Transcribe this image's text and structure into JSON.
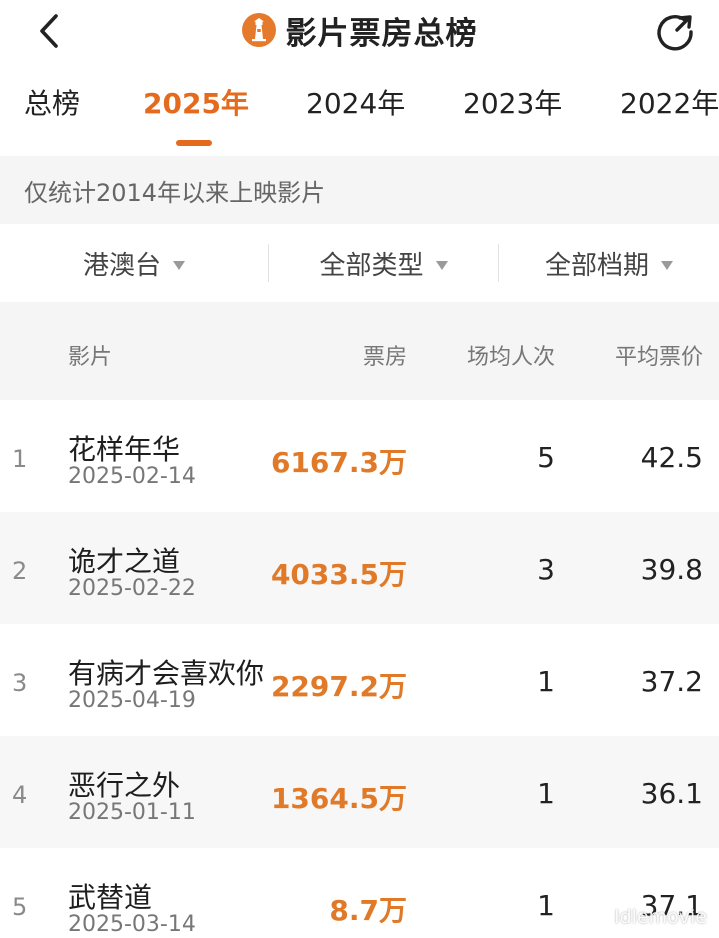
{
  "header": {
    "title": "影片票房总榜",
    "back_icon": "chevron-left-icon",
    "logo_icon": "lighthouse-logo-icon",
    "share_icon": "share-icon"
  },
  "tabs": [
    {
      "label": "总榜",
      "active": false
    },
    {
      "label": "2025年",
      "active": true
    },
    {
      "label": "2024年",
      "active": false
    },
    {
      "label": "2023年",
      "active": false
    },
    {
      "label": "2022年",
      "active": false
    }
  ],
  "notice": "仅统计2014年以来上映影片",
  "filters": [
    {
      "label": "港澳台"
    },
    {
      "label": "全部类型"
    },
    {
      "label": "全部档期"
    }
  ],
  "table": {
    "columns": {
      "film": "影片",
      "box_office": "票房",
      "avg_people": "场均人次",
      "avg_price": "平均票价"
    },
    "rows": [
      {
        "rank": "1",
        "name": "花样年华",
        "date": "2025-02-14",
        "box_office": "6167.3万",
        "avg_people": "5",
        "avg_price": "42.5"
      },
      {
        "rank": "2",
        "name": "诡才之道",
        "date": "2025-02-22",
        "box_office": "4033.5万",
        "avg_people": "3",
        "avg_price": "39.8"
      },
      {
        "rank": "3",
        "name": "有病才会喜欢你",
        "date": "2025-04-19",
        "box_office": "2297.2万",
        "avg_people": "1",
        "avg_price": "37.2"
      },
      {
        "rank": "4",
        "name": "恶行之外",
        "date": "2025-01-11",
        "box_office": "1364.5万",
        "avg_people": "1",
        "avg_price": "36.1"
      },
      {
        "rank": "5",
        "name": "武替道",
        "date": "2025-03-14",
        "box_office": "8.7万",
        "avg_people": "1",
        "avg_price": "37.1"
      }
    ]
  },
  "colors": {
    "accent": "#e46b1d",
    "box_office": "#e07a29",
    "band": "#f5f5f6"
  },
  "watermark": "Idlemovie"
}
